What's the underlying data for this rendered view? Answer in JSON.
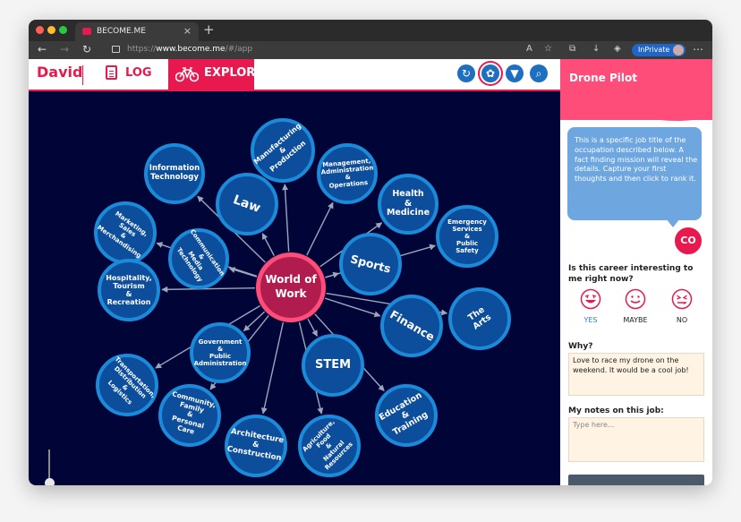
{
  "browser": {
    "tab_title": "BECOME.ME",
    "url_prefix": "https://",
    "url_domain": "www.become.me",
    "url_path": "/#/app",
    "inprivate_label": "InPrivate"
  },
  "header": {
    "user_name": "David",
    "log_label": "LOG",
    "explore_label": "EXPLORE"
  },
  "center_node": {
    "lines": [
      "World",
      "of",
      "Work"
    ]
  },
  "nodes": [
    {
      "id": "manufacturing",
      "lines": [
        "Manufacturing",
        "&",
        "Production"
      ]
    },
    {
      "id": "management",
      "lines": [
        "Management,",
        "Administration",
        "&",
        "Operations"
      ]
    },
    {
      "id": "information-technology",
      "lines": [
        "Information",
        "Technology"
      ]
    },
    {
      "id": "law",
      "lines": [
        "Law"
      ]
    },
    {
      "id": "health",
      "lines": [
        "Health",
        "&",
        "Medicine"
      ]
    },
    {
      "id": "marketing",
      "lines": [
        "Marketing,",
        "Sales",
        "&",
        "Merchandising"
      ]
    },
    {
      "id": "communication",
      "lines": [
        "Communication",
        "&",
        "Media",
        "Technology"
      ]
    },
    {
      "id": "emergency",
      "lines": [
        "Emergency",
        "Services",
        "&",
        "Public",
        "Safety"
      ]
    },
    {
      "id": "sports",
      "lines": [
        "Sports"
      ]
    },
    {
      "id": "hospitality",
      "lines": [
        "Hospitality,",
        "Tourism",
        "&",
        "Recreation"
      ]
    },
    {
      "id": "the-arts",
      "lines": [
        "The",
        "Arts"
      ]
    },
    {
      "id": "finance",
      "lines": [
        "Finance"
      ]
    },
    {
      "id": "government",
      "lines": [
        "Government",
        "&",
        "Public",
        "Administration"
      ]
    },
    {
      "id": "stem",
      "lines": [
        "STEM"
      ]
    },
    {
      "id": "transportation",
      "lines": [
        "Transportation,",
        "Distribution",
        "&",
        "Logistics"
      ]
    },
    {
      "id": "community",
      "lines": [
        "Community,",
        "Family",
        "&",
        "Personal",
        "Care"
      ]
    },
    {
      "id": "education",
      "lines": [
        "Education",
        "&",
        "Training"
      ]
    },
    {
      "id": "architecture",
      "lines": [
        "Architecture",
        "&",
        "Construction"
      ]
    },
    {
      "id": "agriculture",
      "lines": [
        "Agriculture,",
        "Food",
        "&",
        "Natural",
        "Resources"
      ]
    }
  ],
  "panel": {
    "title": "Drone Pilot",
    "description": "This is a specific job title of the occupation described below. A fact finding mission will reveal the details. Capture your first thoughts and then click to rank it.",
    "coin_label": "CO",
    "question": "Is this career interesting to me right now?",
    "ratings": [
      {
        "id": "yes",
        "label": "YES",
        "selected": true
      },
      {
        "id": "maybe",
        "label": "MAYBE",
        "selected": false
      },
      {
        "id": "no",
        "label": "NO",
        "selected": false
      }
    ],
    "why_label": "Why?",
    "why_value": "Love to race my drone on the weekend.  It would be a cool job!",
    "notes_label": "My notes on this job:",
    "notes_placeholder": "Type here..."
  },
  "colors": {
    "accent": "#e8194e",
    "node_fill": "#0d4e9c",
    "node_ring": "#1a8ad9",
    "canvas": "#010437"
  }
}
